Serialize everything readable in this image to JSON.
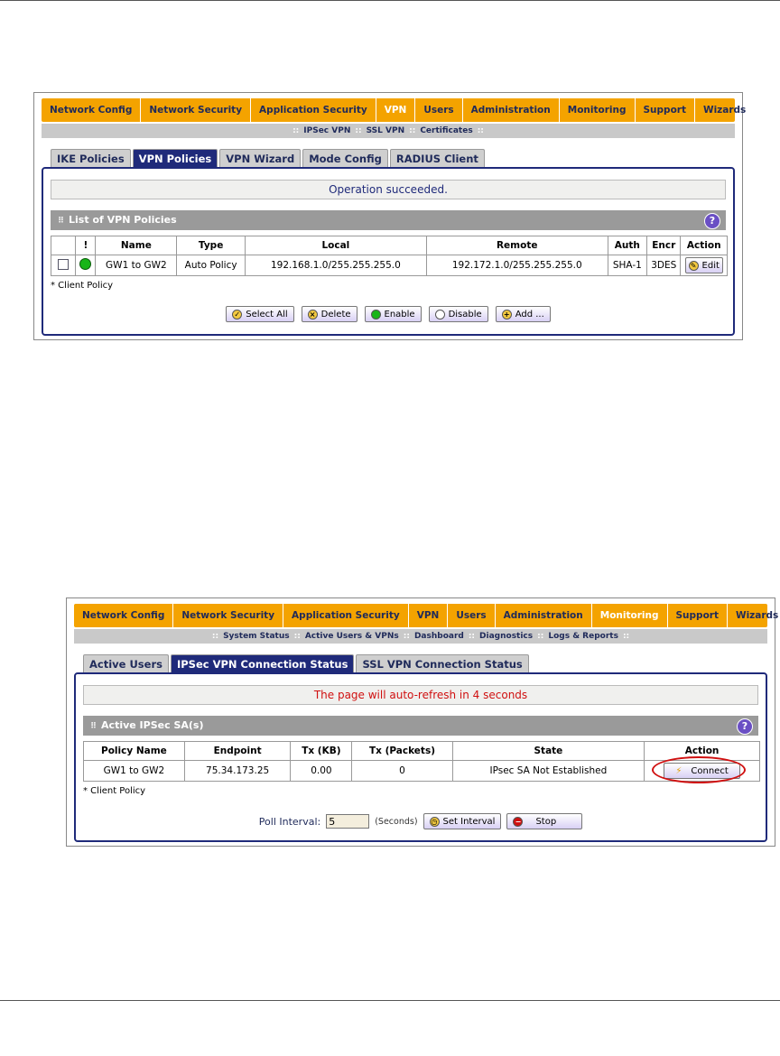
{
  "panel1": {
    "menu": [
      "Network Config",
      "Network Security",
      "Application Security",
      "VPN",
      "Users",
      "Administration",
      "Monitoring",
      "Support",
      "Wizards"
    ],
    "active_menu": "VPN",
    "submenu": [
      "IPSec VPN",
      "SSL VPN",
      "Certificates"
    ],
    "tabs": [
      "IKE Policies",
      "VPN Policies",
      "VPN Wizard",
      "Mode Config",
      "RADIUS Client"
    ],
    "active_tab": "VPN Policies",
    "message": "Operation succeeded.",
    "section_title": "List of VPN Policies",
    "help_icon": "?",
    "columns": [
      "",
      "!",
      "Name",
      "Type",
      "Local",
      "Remote",
      "Auth",
      "Encr",
      "Action"
    ],
    "row": {
      "name": "GW1 to GW2",
      "type": "Auto Policy",
      "local": "192.168.1.0/255.255.255.0",
      "remote": "192.172.1.0/255.255.255.0",
      "auth": "SHA-1",
      "encr": "3DES",
      "action": "Edit"
    },
    "note": "* Client Policy",
    "buttons": {
      "select_all": "Select All",
      "delete": "Delete",
      "enable": "Enable",
      "disable": "Disable",
      "add": "Add ..."
    }
  },
  "panel2": {
    "menu": [
      "Network Config",
      "Network Security",
      "Application Security",
      "VPN",
      "Users",
      "Administration",
      "Monitoring",
      "Support",
      "Wizards"
    ],
    "active_menu": "Monitoring",
    "submenu": [
      "System Status",
      "Active Users & VPNs",
      "Dashboard",
      "Diagnostics",
      "Logs & Reports"
    ],
    "tabs": [
      "Active Users",
      "IPSec VPN Connection Status",
      "SSL VPN Connection Status"
    ],
    "active_tab": "IPSec VPN Connection Status",
    "message": "The page will auto-refresh in 4 seconds",
    "section_title": "Active IPSec SA(s)",
    "help_icon": "?",
    "columns": [
      "Policy Name",
      "Endpoint",
      "Tx (KB)",
      "Tx (Packets)",
      "State",
      "Action"
    ],
    "row": {
      "policy_name": "GW1 to GW2",
      "endpoint": "75.34.173.25",
      "tx_kb": "0.00",
      "tx_packets": "0",
      "state": "IPsec SA Not Established",
      "action": "Connect"
    },
    "note": "* Client Policy",
    "poll_label": "Poll Interval:",
    "poll_value": "5",
    "poll_unit": "(Seconds)",
    "buttons": {
      "set_interval": "Set Interval",
      "stop": "Stop"
    }
  },
  "colors": {
    "menu_bg": "#f4a300",
    "tab_active": "#1f2a7a",
    "message_red": "#d01010",
    "highlight_ellipse": "#d01010"
  }
}
